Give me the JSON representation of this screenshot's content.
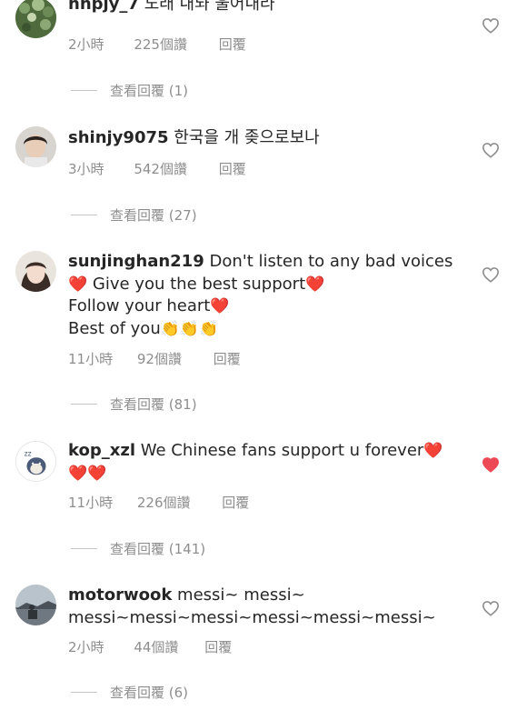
{
  "comments": [
    {
      "username": "hnpjy_7",
      "text": "노래 내놔 울어내라",
      "time": "2小時",
      "likes": "225個讚",
      "reply": "回覆",
      "view_replies": "查看回覆 (1)",
      "liked": false
    },
    {
      "username": "shinjy9075",
      "text": "한국을 개 좆으로보나",
      "time": "3小時",
      "likes": "542個讚",
      "reply": "回覆",
      "view_replies": "查看回覆 (27)",
      "liked": false
    },
    {
      "username": "sunjinghan219",
      "text_line1": "Don't listen to any bad voices",
      "text_line2": "Give you the best support",
      "text_line3": "Follow your heart",
      "text_line4": "Best of you",
      "time": "11小時",
      "likes": "92個讚",
      "reply": "回覆",
      "view_replies": "查看回覆 (81)",
      "liked": false
    },
    {
      "username": "kop_xzl",
      "text": "We Chinese fans support u forever",
      "time": "11小時",
      "likes": "226個讚",
      "reply": "回覆",
      "view_replies": "查看回覆 (141)",
      "liked": true
    },
    {
      "username": "motorwook",
      "text_line1": "messi~ messi~",
      "text_line2": "messi~messi~messi~messi~messi~messi~",
      "time": "2小時",
      "likes": "44個讚",
      "reply": "回覆",
      "view_replies": "查看回覆 (6)",
      "liked": false
    }
  ],
  "emoji": {
    "heart": "❤️",
    "clap": "👏"
  },
  "colors": {
    "text": "#262626",
    "muted": "#8e8e8e",
    "liked_heart": "#ed4956",
    "outline_heart": "#8e8e8e"
  }
}
